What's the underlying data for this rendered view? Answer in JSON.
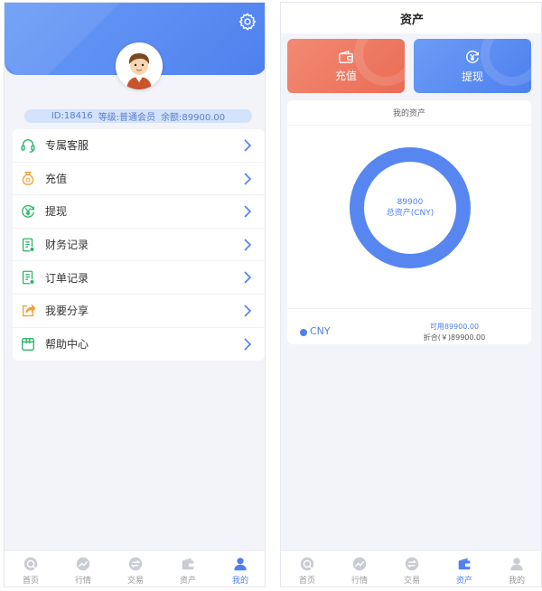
{
  "left": {
    "info": {
      "id": "ID:18416",
      "level": "等级:普通会员",
      "balance": "余额:89900.00"
    },
    "menu": [
      {
        "label": "专属客服",
        "icon": "headset-icon"
      },
      {
        "label": "充值",
        "icon": "money-bag-icon"
      },
      {
        "label": "提现",
        "icon": "yuan-circle-icon"
      },
      {
        "label": "财务记录",
        "icon": "finance-record-icon"
      },
      {
        "label": "订单记录",
        "icon": "order-record-icon"
      },
      {
        "label": "我要分享",
        "icon": "share-icon"
      },
      {
        "label": "帮助中心",
        "icon": "help-book-icon"
      }
    ]
  },
  "right": {
    "title": "资产",
    "recharge_label": "充值",
    "withdraw_label": "提现",
    "card_title": "我的资产",
    "total_value": "89900",
    "total_label": "总资产(CNY)",
    "currency": "CNY",
    "available": "可用89900.00",
    "folded": "折合(￥)89900.00"
  },
  "tabs": [
    {
      "label": "首页",
      "icon": "home-icon"
    },
    {
      "label": "行情",
      "icon": "market-icon"
    },
    {
      "label": "交易",
      "icon": "trade-icon"
    },
    {
      "label": "资产",
      "icon": "wallet-icon"
    },
    {
      "label": "我的",
      "icon": "user-icon"
    }
  ],
  "left_active_tab": "我的",
  "right_active_tab": "资产",
  "colors": {
    "primary": "#4f80ee",
    "recharge": "#ea6c55",
    "background": "#f2f4f9"
  }
}
